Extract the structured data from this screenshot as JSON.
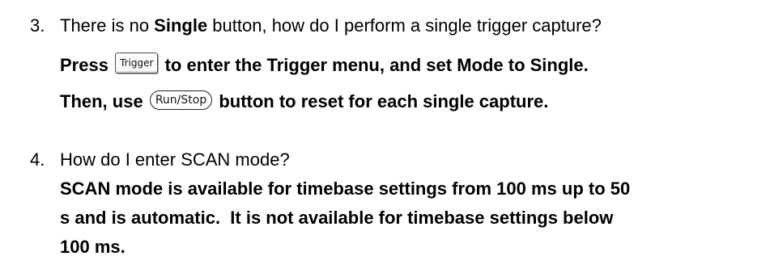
{
  "faq": [
    {
      "number": "3.",
      "question_pre": "There is no ",
      "question_bold": "Single",
      "question_post": " button, how do I perform a single trigger capture?",
      "answer_line1_pre": "Press",
      "trigger_key_label": "Trigger",
      "answer_line1_post": "to enter the Trigger menu, and set Mode to Single.",
      "answer_line2_pre": "Then, use",
      "runstop_key_label": "Run/Stop",
      "answer_line2_post": "button to reset for each single capture."
    },
    {
      "number": "4.",
      "question": "How do I enter SCAN mode?",
      "answer_line1": "SCAN mode is available for timebase settings from 100 ms up to 50",
      "answer_line2": "s and is automatic.  It is not available for timebase settings below",
      "answer_line3": "100 ms."
    }
  ]
}
